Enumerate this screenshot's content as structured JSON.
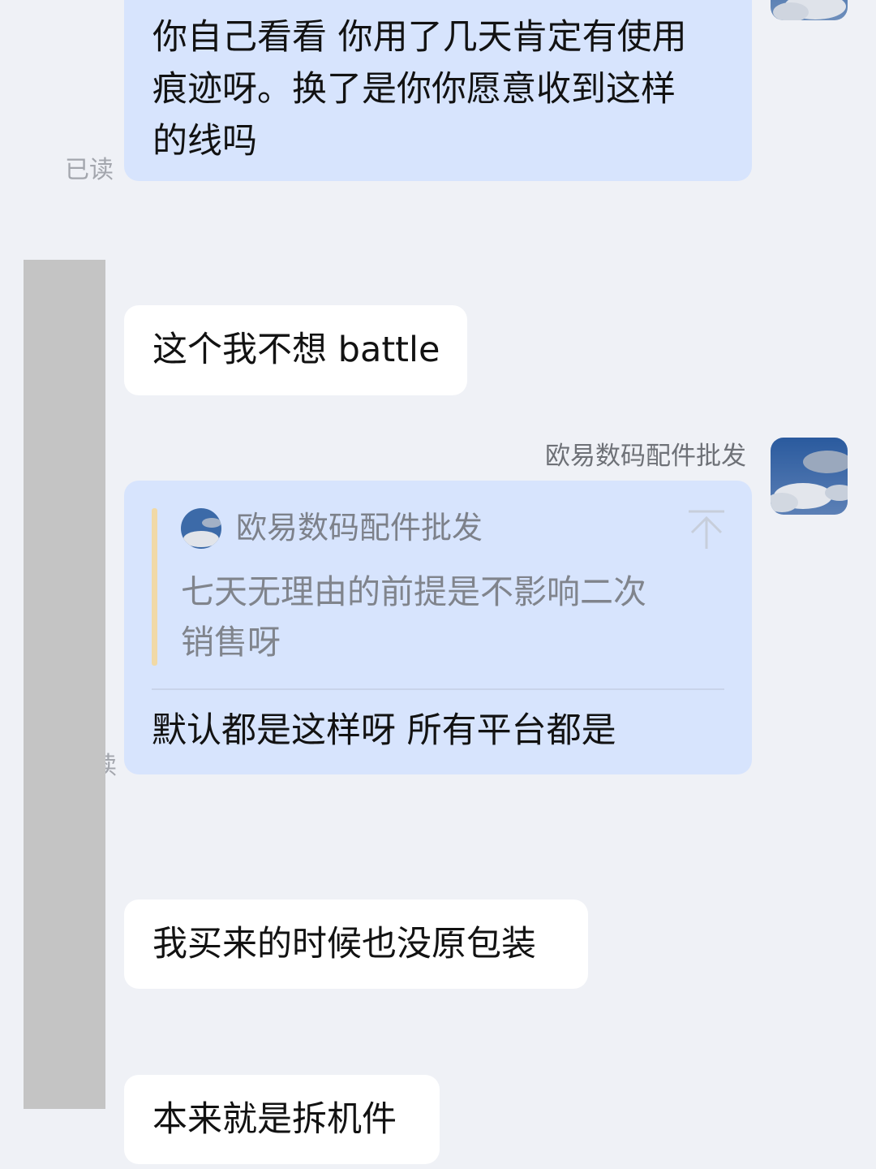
{
  "messages": [
    {
      "side": "self",
      "text": "你自己看看 你用了几天肯定有使用痕迹呀。换了是你你愿意收到这样的线吗",
      "lines": [
        "你自己看看 你用了几天肯定有使用",
        "痕迹呀。换了是你你愿意收到这样",
        "的线吗"
      ],
      "status": "已读"
    },
    {
      "side": "other",
      "text": "这个我不想 battle"
    },
    {
      "side": "self",
      "sender": "欧易数码配件批发",
      "quote": {
        "author": "欧易数码配件批发",
        "lines": [
          "七天无理由的前提是不影响二次",
          "销售呀"
        ]
      },
      "text": "默认都是这样呀 所有平台都是",
      "status_partial": "读"
    },
    {
      "side": "other",
      "text": "我买来的时候也没原包装"
    },
    {
      "side": "other",
      "text": "本来就是拆机件"
    }
  ],
  "icons": {
    "avatar": "sky-clouds-avatar-icon",
    "scroll_top": "arrow-up-to-top-icon"
  },
  "colors": {
    "background": "#eff1f6",
    "self_bubble": "#d7e4fd",
    "other_bubble": "#ffffff",
    "quote_bar": "#f1d9a6",
    "redaction": "#c4c4c4"
  }
}
